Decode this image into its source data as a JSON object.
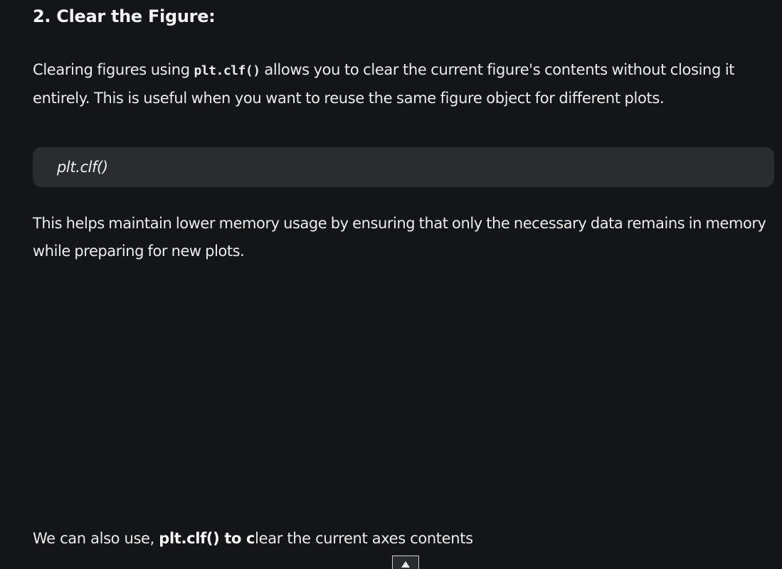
{
  "section": {
    "heading": "2. Clear the Figure:"
  },
  "para1": {
    "before": "Clearing figures using ",
    "code": "plt.clf()",
    "after": " allows you to clear the current figure's contents without closing it entirely. This is useful when you want to reuse the same figure object for different plots."
  },
  "code_block": {
    "code": "plt.clf()"
  },
  "para2": {
    "text": "This helps maintain lower memory usage by ensuring that only the necessary data remains in memory while preparing for new plots."
  },
  "para3": {
    "before": "We can also use, ",
    "bold": "plt.clf() to c",
    "after": "lear the current axes contents"
  },
  "scroll_top": {
    "icon": "arrow-up-icon"
  }
}
